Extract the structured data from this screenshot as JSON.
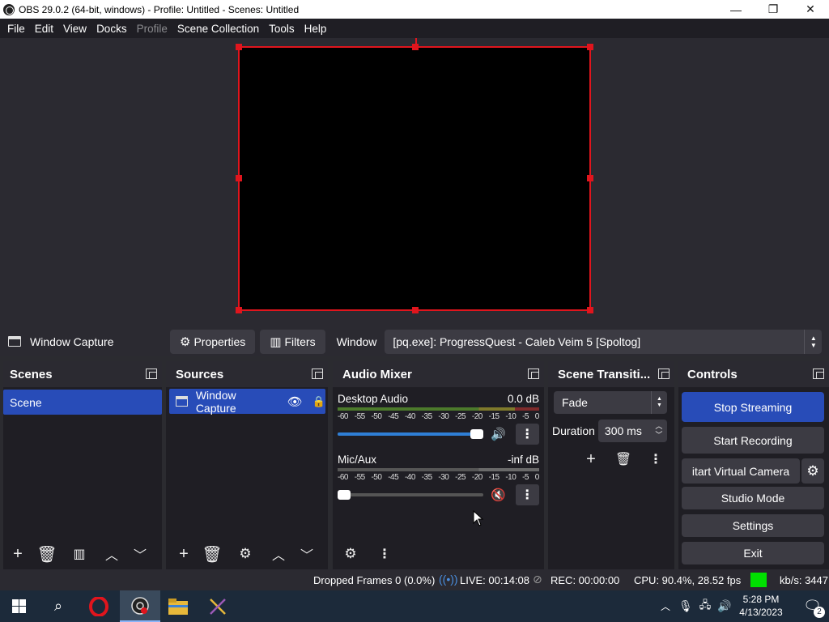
{
  "window": {
    "title": "OBS 29.0.2 (64-bit, windows) - Profile: Untitled - Scenes: Untitled",
    "minimize": "—",
    "maximize": "❐",
    "close": "✕"
  },
  "menu": [
    "File",
    "Edit",
    "View",
    "Docks",
    "Profile",
    "Scene Collection",
    "Tools",
    "Help"
  ],
  "source_toolbar": {
    "source_name": "Window Capture",
    "properties_label": "Properties",
    "filters_label": "Filters",
    "window_label": "Window",
    "window_value": "[pq.exe]: ProgressQuest - Caleb Veim 5 [Spoltog]"
  },
  "scenes": {
    "title": "Scenes",
    "items": [
      "Scene"
    ]
  },
  "sources": {
    "title": "Sources",
    "items": [
      "Window Capture"
    ]
  },
  "mixer": {
    "title": "Audio Mixer",
    "ticks": [
      "-60",
      "-55",
      "-50",
      "-45",
      "-40",
      "-35",
      "-30",
      "-25",
      "-20",
      "-15",
      "-10",
      "-5",
      "0"
    ],
    "channels": [
      {
        "name": "Desktop Audio",
        "level": "0.0 dB",
        "volume": 1.0,
        "muted": false
      },
      {
        "name": "Mic/Aux",
        "level": "-inf dB",
        "volume": 0.0,
        "muted": true
      }
    ]
  },
  "transitions": {
    "title": "Scene Transiti...",
    "selected": "Fade",
    "duration_label": "Duration",
    "duration_value": "300 ms"
  },
  "controls": {
    "title": "Controls",
    "stop_streaming": "Stop Streaming",
    "start_recording": "Start Recording",
    "start_virtual_camera": "itart Virtual Camera",
    "studio_mode": "Studio Mode",
    "settings": "Settings",
    "exit": "Exit"
  },
  "status": {
    "dropped_frames": "Dropped Frames 0 (0.0%)",
    "live": "LIVE: 00:14:08",
    "rec": "REC: 00:00:00",
    "cpu": "CPU: 90.4%, 28.52 fps",
    "kbs": "kb/s: 3447"
  },
  "taskbar": {
    "time": "5:28 PM",
    "date": "4/13/2023",
    "notification_count": "2"
  },
  "colors": {
    "accent": "#284cb8",
    "selection_border": "#e0151d",
    "status_ok": "#00e000"
  }
}
